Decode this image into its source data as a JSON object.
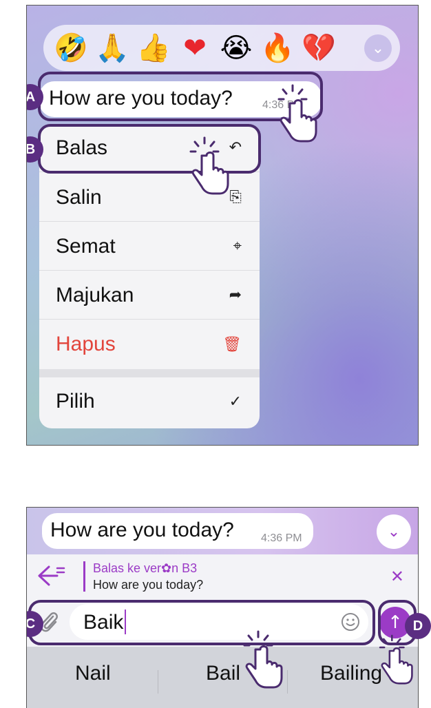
{
  "reactions": [
    "🤣",
    "🙏",
    "👍",
    "❤",
    "😭",
    "🔥",
    "💔"
  ],
  "reactions_more_icon": "⌄",
  "message": {
    "text": "How are you today?",
    "time": "4:36 PM"
  },
  "menu": [
    {
      "label": "Balas",
      "icon": "↶"
    },
    {
      "label": "Salin",
      "icon": "⎘"
    },
    {
      "label": "Semat",
      "icon": "⌖"
    },
    {
      "label": "Majukan",
      "icon": "➦"
    },
    {
      "label": "Hapus",
      "icon": "🗑"
    },
    {
      "label": "Pilih",
      "icon": "✓"
    }
  ],
  "callouts": {
    "a": "A",
    "b": "B",
    "c": "C",
    "d": "D"
  },
  "reply": {
    "label": "Balas ke ver✿n B3",
    "quote": "How are you today?",
    "close": "✕"
  },
  "input": {
    "value": "Baik"
  },
  "send_icon": "↑",
  "suggestions": [
    "Nail",
    "Bail",
    "Bailing"
  ],
  "colors": {
    "accent": "#9b3bc6",
    "danger": "#e2453c",
    "callout": "#5b2d82"
  }
}
